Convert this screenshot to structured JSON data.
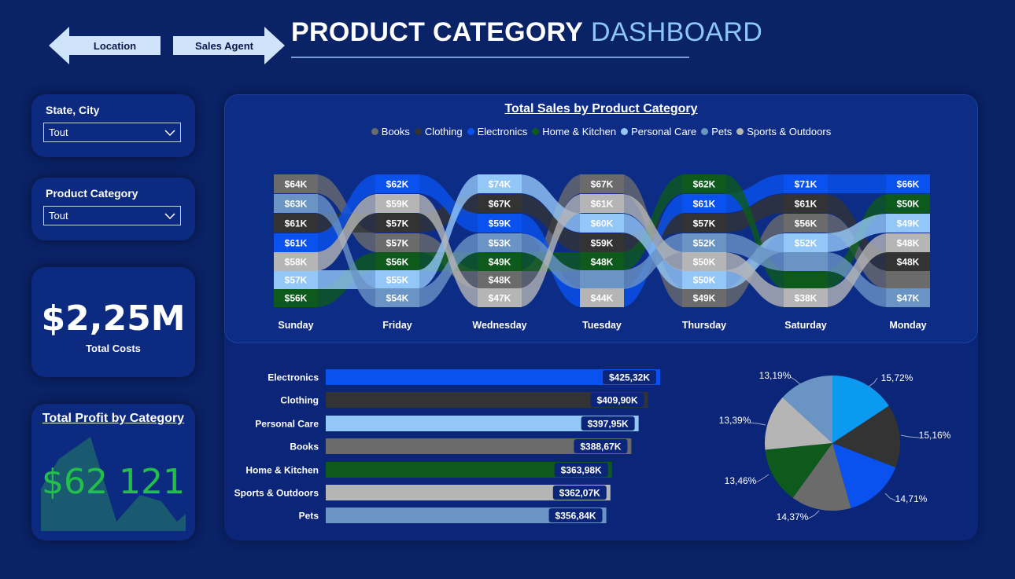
{
  "nav": {
    "back_label": "Location",
    "forward_label": "Sales Agent"
  },
  "header": {
    "title_main": "PRODUCT CATEGORY",
    "title_accent": "DASHBOARD"
  },
  "filters": {
    "state_city": {
      "label": "State, City",
      "value": "Tout"
    },
    "category": {
      "label": "Product Category",
      "value": "Tout"
    }
  },
  "kpi": {
    "total_costs": {
      "value": "$2,25M",
      "label": "Total Costs"
    },
    "total_profit": {
      "title": "Total Profit by Category",
      "value": "$62 121"
    }
  },
  "colors": {
    "Books": "#6b6b6b",
    "Clothing": "#333333",
    "Electronics": "#0a52f0",
    "Home & Kitchen": "#0d5a1c",
    "Personal Care": "#93c7f7",
    "Pets": "#6a94c4",
    "Sports & Outdoors": "#b5b5b5"
  },
  "chart_data": [
    {
      "type": "ribbon",
      "title": "Total Sales by Product Category",
      "legend": [
        "Books",
        "Clothing",
        "Electronics",
        "Home & Kitchen",
        "Personal Care",
        "Pets",
        "Sports & Outdoors"
      ],
      "days": [
        "Sunday",
        "Friday",
        "Wednesday",
        "Tuesday",
        "Thursday",
        "Saturday",
        "Monday"
      ],
      "series": [
        {
          "name": "Books",
          "labels": [
            "$64K",
            "$57K",
            "$48K",
            "$67K",
            "$49K",
            "$56K",
            ""
          ]
        },
        {
          "name": "Clothing",
          "labels": [
            "$61K",
            "$57K",
            "$67K",
            "$59K",
            "$57K",
            "$61K",
            "$48K"
          ]
        },
        {
          "name": "Electronics",
          "labels": [
            "$61K",
            "$62K",
            "$59K",
            "",
            "$61K",
            "$71K",
            "$66K"
          ]
        },
        {
          "name": "Home & Kitchen",
          "labels": [
            "$56K",
            "$56K",
            "$49K",
            "$48K",
            "$62K",
            "",
            "$50K"
          ]
        },
        {
          "name": "Personal Care",
          "labels": [
            "$57K",
            "$55K",
            "$74K",
            "$60K",
            "$50K",
            "$52K",
            "$49K"
          ]
        },
        {
          "name": "Pets",
          "labels": [
            "$63K",
            "$54K",
            "$53K",
            "",
            "$52K",
            "",
            "$47K"
          ]
        },
        {
          "name": "Sports & Outdoors",
          "labels": [
            "$58K",
            "$59K",
            "$47K",
            "$61K",
            "$50K",
            "$38K",
            "$48K"
          ]
        },
        {
          "name": "Tuesday-extra",
          "labels": [
            "",
            "",
            "",
            "$44K",
            "",
            "",
            ""
          ]
        }
      ]
    },
    {
      "type": "bar",
      "categories": [
        "Electronics",
        "Clothing",
        "Personal Care",
        "Books",
        "Home & Kitchen",
        "Sports & Outdoors",
        "Pets"
      ],
      "values": [
        425.32,
        409.9,
        397.95,
        388.67,
        363.98,
        362.07,
        356.84
      ],
      "value_labels": [
        "$425,32K",
        "$409,90K",
        "$397,95K",
        "$388,67K",
        "$363,98K",
        "$362,07K",
        "$356,84K"
      ]
    },
    {
      "type": "pie",
      "slices": [
        {
          "category": "Electronics",
          "value": 15.72,
          "label": "15,72%",
          "color": "#0a9bf0"
        },
        {
          "category": "Clothing",
          "value": 15.16,
          "label": "15,16%",
          "color": "#333333"
        },
        {
          "category": "Electronics",
          "value": 14.71,
          "label": "14,71%",
          "color": "#0a52f0"
        },
        {
          "category": "Books",
          "value": 14.37,
          "label": "14,37%",
          "color": "#6b6b6b"
        },
        {
          "category": "Home & Kitchen",
          "value": 13.46,
          "label": "13,46%",
          "color": "#0d5a1c"
        },
        {
          "category": "Sports & Outdoors",
          "value": 13.39,
          "label": "13,39%",
          "color": "#b5b5b5"
        },
        {
          "category": "Pets",
          "value": 13.19,
          "label": "13,19%",
          "color": "#6a94c4"
        }
      ]
    }
  ]
}
